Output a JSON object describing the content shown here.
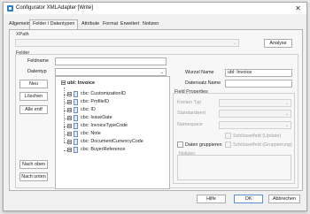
{
  "window": {
    "title": "Configurator XMLAdapter [Write]",
    "close_glyph": "✕"
  },
  "tabs": [
    {
      "label": "Allgemein"
    },
    {
      "label": "Felder / Datentypen"
    },
    {
      "label": "Attribute"
    },
    {
      "label": "Format"
    },
    {
      "label": "Erweitert"
    },
    {
      "label": "Notizen"
    }
  ],
  "xpath": {
    "label": "XPath",
    "value": "",
    "analyse_button": "Analyse"
  },
  "felder": {
    "label": "Felder",
    "feldname_label": "Feldname",
    "feldname_value": "",
    "datentyp_label": "Datentyp",
    "datentyp_value": "",
    "buttons": {
      "neu": "Neu",
      "loeschen": "Löschen",
      "alle_entf": "Alle entf",
      "nach_oben": "Nach oben",
      "nach_unten": "Nach unten"
    },
    "tree": {
      "root": "ubl: Invoice",
      "children": [
        "cbc: CustomizationID",
        "cbc: ProfileID",
        "cbc: ID",
        "cbc: IssueDate",
        "cbc: InvoiceTypeCode",
        "cbc: Note",
        "cbc: DocumentCurrencyCode",
        "cbc: BuyerReference"
      ]
    }
  },
  "right": {
    "wurzel_name_label": "Wurzel Name",
    "wurzel_name_value": "ubl: Invoice",
    "datensatz_name_label": "Datensatz Name",
    "datensatz_name_value": "",
    "field_properties": {
      "label": "Field Properties",
      "knoten_typ_label": "Knoten Typ",
      "standardwert_label": "Standardwert",
      "namespace_label": "Namespace",
      "schluesselfeld_update": "Schlüsselfeld (Update)",
      "daten_gruppieren": "Daten gruppieren",
      "schluesselfeld_gruppierung": "Schlüsselfeld (Gruppierung)",
      "notizen_label": "Notizen"
    }
  },
  "footer": {
    "hilfe": "Hilfe",
    "ok": "OK",
    "abbrechen": "Abbrechen"
  }
}
